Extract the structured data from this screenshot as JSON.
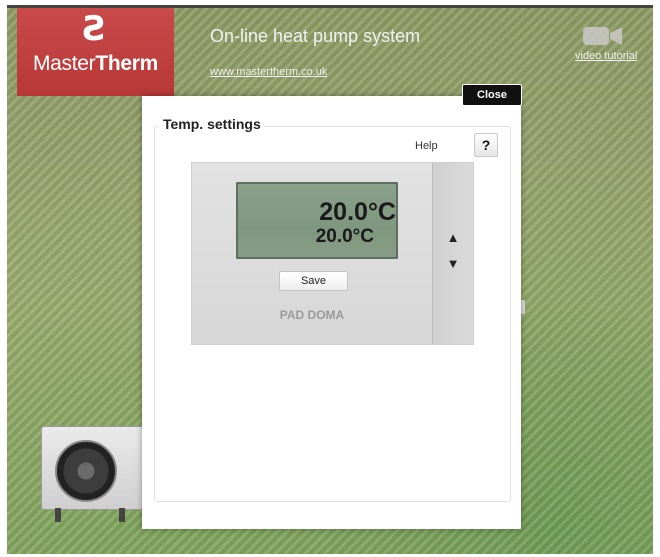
{
  "header": {
    "logo_mark": "Ƨ",
    "logo_text_light": "Master",
    "logo_text_bold": "Therm",
    "title": "On-line heat pump system",
    "url": "www.mastertherm.co.uk",
    "video_label": "video tutorial"
  },
  "dialog": {
    "close_label": "Close",
    "legend": "Temp. settings",
    "help_label": "Help",
    "help_button": "?",
    "thermostat": {
      "display_main": "20.0°C",
      "display_sub": "20.0°C",
      "up_arrow": "▲",
      "down_arrow": "▼",
      "save_label": "Save",
      "zone_name": "PAD DOMA"
    }
  },
  "colors": {
    "brand_red": "#c0403f",
    "lcd_green": "#819880",
    "background_green": "#95a26b"
  }
}
